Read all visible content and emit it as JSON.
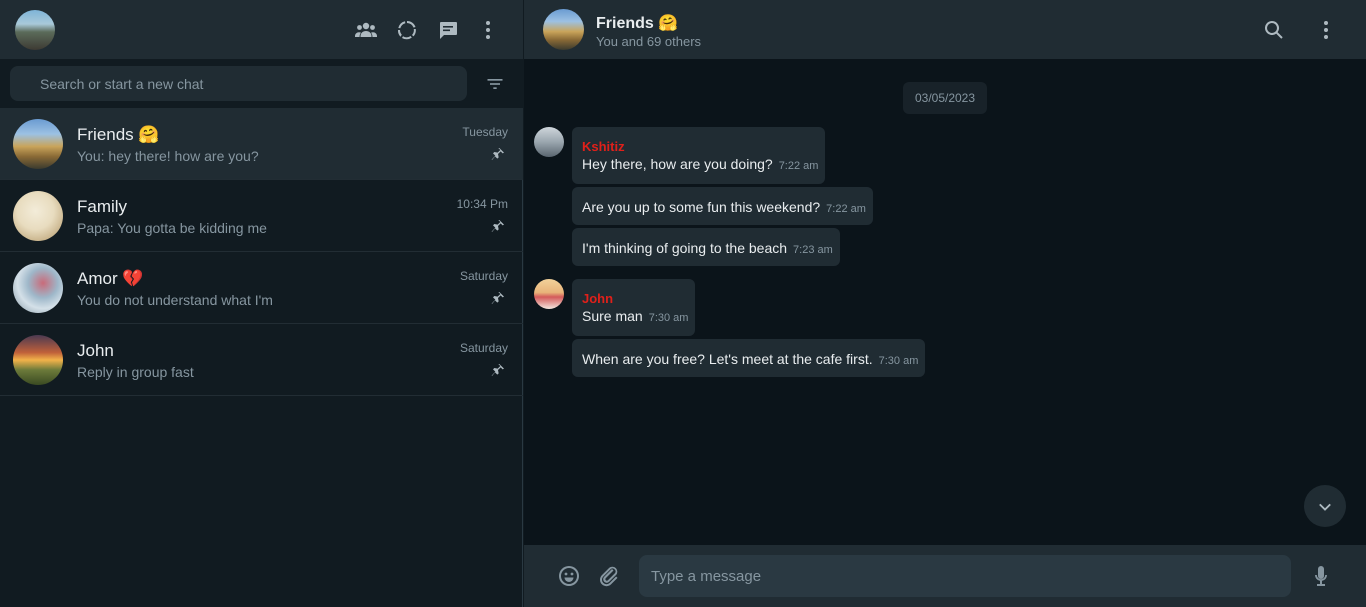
{
  "left_header": {
    "icons": [
      "community-icon",
      "status-icon",
      "new-chat-icon",
      "menu-icon"
    ]
  },
  "search": {
    "placeholder": "Search or start a new chat"
  },
  "chats": [
    {
      "name": "Friends 🤗",
      "preview": "You: hey there! how are you?",
      "time": "Tuesday",
      "pinned": true,
      "active": true
    },
    {
      "name": "Family",
      "preview": "Papa: You gotta be kidding me",
      "time": "10:34 Pm",
      "pinned": true,
      "active": false
    },
    {
      "name": "Amor 💔",
      "preview": "You do not understand what I'm",
      "time": "Saturday",
      "pinned": true,
      "active": false
    },
    {
      "name": "John",
      "preview": "Reply in group fast",
      "time": "Saturday",
      "pinned": true,
      "active": false
    }
  ],
  "conversation": {
    "title": "Friends 🤗",
    "subtitle": "You and 69 others",
    "date_chip": "03/05/2023",
    "messages": [
      {
        "sender": "Kshitiz",
        "text": "Hey there, how are you doing?",
        "time": "7:22 am"
      },
      {
        "sender": "",
        "text": "Are you up to some fun this weekend?",
        "time": "7:22 am"
      },
      {
        "sender": "",
        "text": "I'm thinking of going to the beach",
        "time": "7:23 am"
      },
      {
        "sender": "John",
        "text": "Sure man",
        "time": "7:30 am"
      },
      {
        "sender": "",
        "text": "When are you free? Let's meet at the cafe first.",
        "time": "7:30 am"
      }
    ]
  },
  "composer": {
    "placeholder": "Type a message"
  },
  "colors": {
    "sender_name": "#e0201a",
    "panel_header": "#202c33",
    "background": "#0b141a"
  }
}
